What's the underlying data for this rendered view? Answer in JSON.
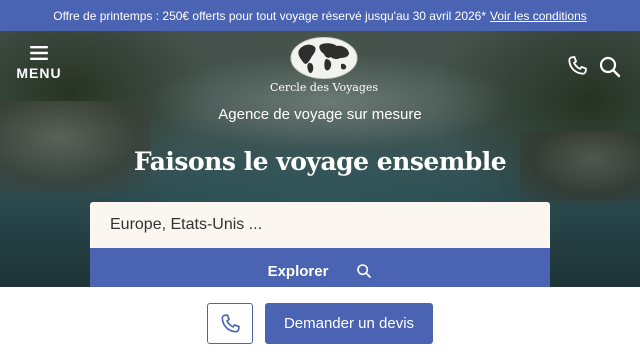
{
  "promo_banner": {
    "text": "Offre de printemps : 250€ offerts pour tout voyage réservé jusqu'au 30 avril 2026*",
    "link_label": "Voir les conditions"
  },
  "header": {
    "menu_label": "MENU",
    "menu_icon": "hamburger-icon",
    "logo_text": "Cercle des Voyages",
    "logo_icon": "world-map-icon",
    "phone_icon": "phone-icon",
    "search_icon": "search-icon"
  },
  "hero": {
    "tagline": "Agence de voyage sur mesure",
    "headline_part1": "Faisons le ",
    "headline_bold": "voyage",
    "headline_part2": " ensemble",
    "search_placeholder": "Europe, Etats-Unis ...",
    "explore_label": "Explorer"
  },
  "bottom_bar": {
    "phone_icon": "phone-icon",
    "quote_label": "Demander un devis"
  },
  "colors": {
    "primary": "#4a63b3",
    "input_bg": "#fbf6f0",
    "text_on_primary": "#ffffff"
  }
}
